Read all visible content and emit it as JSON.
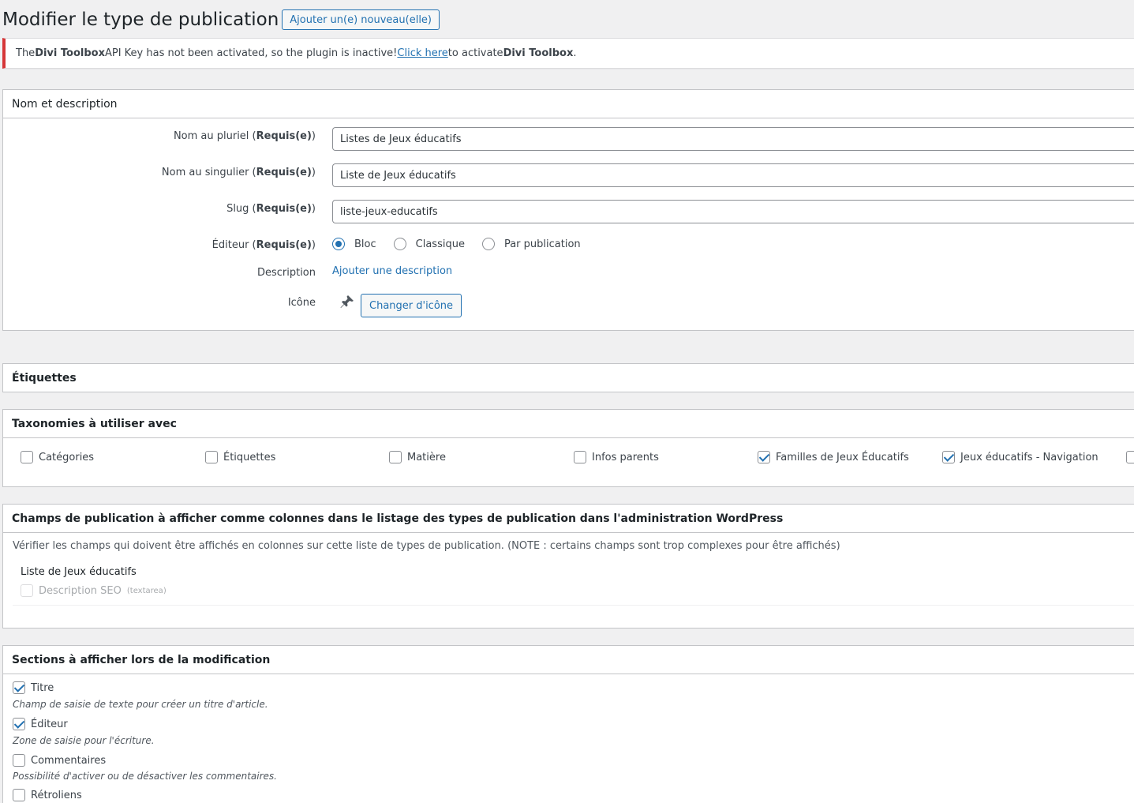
{
  "page": {
    "title": "Modifier le type de publication",
    "add_new_label": "Ajouter un(e) nouveau(elle)"
  },
  "notice": {
    "prefix": "The ",
    "plugin": "Divi Toolbox",
    "middle": " API Key has not been activated, so the plugin is inactive! ",
    "link": "Click here",
    "suffix": " to activate ",
    "plugin2": "Divi Toolbox",
    "end": "."
  },
  "name_section": {
    "title": "Nom et description",
    "required": "Requis(e)",
    "plural_label": "Nom au pluriel",
    "plural_value": "Listes de Jeux éducatifs",
    "singular_label": "Nom au singulier",
    "singular_value": "Liste de Jeux éducatifs",
    "slug_label": "Slug",
    "slug_value": "liste-jeux-educatifs",
    "editor_label": "Éditeur",
    "editor_options": [
      "Bloc",
      "Classique",
      "Par publication"
    ],
    "editor_selected": "Bloc",
    "description_label": "Description",
    "description_link": "Ajouter une description",
    "icon_label": "Icône",
    "icon": "pushpin-icon",
    "change_icon_label": "Changer d'icône"
  },
  "labels_section": {
    "title": "Étiquettes"
  },
  "taxonomies": {
    "title": "Taxonomies à utiliser avec",
    "items": [
      {
        "label": "Catégories",
        "checked": false
      },
      {
        "label": "Étiquettes",
        "checked": false
      },
      {
        "label": "Matière",
        "checked": false
      },
      {
        "label": "Infos parents",
        "checked": false
      },
      {
        "label": "Familles de Jeux Éducatifs",
        "checked": true
      },
      {
        "label": "Jeux éducatifs - Navigation",
        "checked": true
      }
    ]
  },
  "columns_section": {
    "title": "Champs de publication à afficher comme colonnes dans le listage des types de publication dans l'administration WordPress",
    "help": "Vérifier les champs qui doivent être affichés en colonnes sur cette liste de types de publication. (NOTE : certains champs sont trop complexes pour être affichés)",
    "group": "Liste de Jeux éducatifs",
    "field": "Description SEO",
    "field_type": "(textarea)"
  },
  "sections": {
    "title": "Sections à afficher lors de la modification",
    "items": [
      {
        "label": "Titre",
        "checked": true,
        "desc": "Champ de saisie de texte pour créer un titre d'article."
      },
      {
        "label": "Éditeur",
        "checked": true,
        "desc": "Zone de saisie pour l'écriture."
      },
      {
        "label": "Commentaires",
        "checked": false,
        "desc": "Possibilité d'activer ou de désactiver les commentaires."
      },
      {
        "label": "Rétroliens",
        "checked": false,
        "desc": ""
      }
    ]
  },
  "colors": {
    "accent": "#2271b1",
    "error": "#d63638",
    "background": "#f0f0f1"
  }
}
